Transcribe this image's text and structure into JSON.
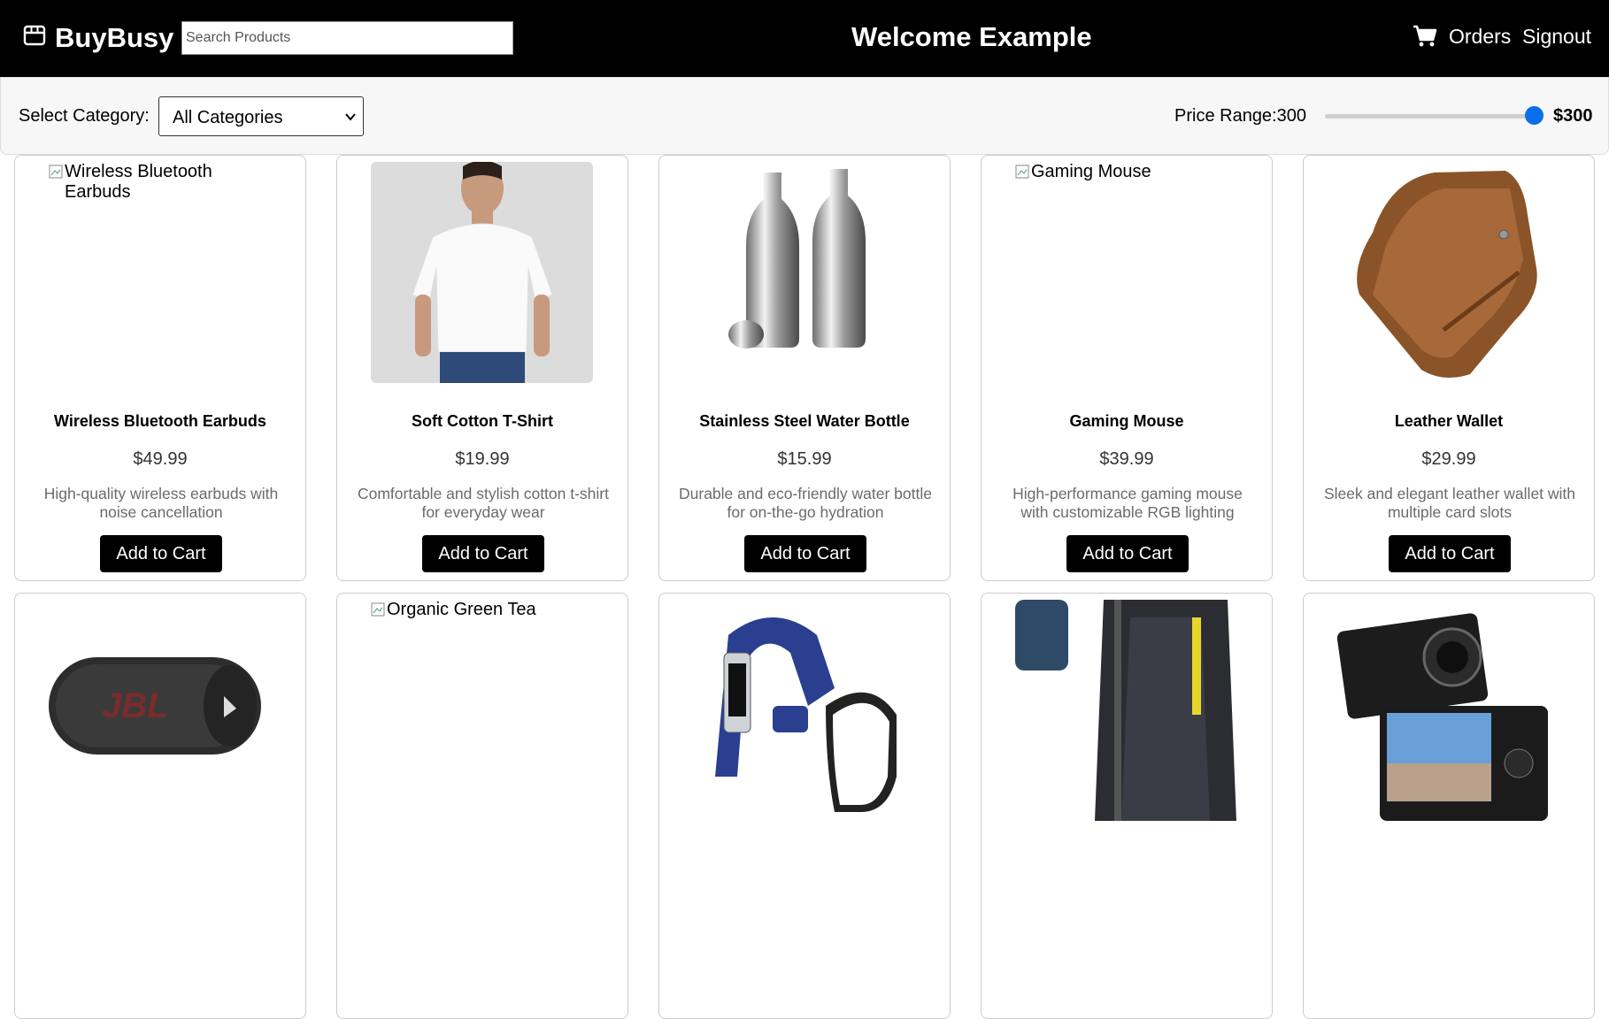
{
  "header": {
    "brand": "BuyBusy",
    "search_placeholder": "Search Products",
    "welcome": "Welcome Example",
    "nav_orders": "Orders",
    "nav_signout": "Signout"
  },
  "filters": {
    "category_label": "Select Category:",
    "category_selected": "All Categories",
    "price_label": "Price Range:300",
    "price_value": "$300",
    "price_slider_level": 1.0
  },
  "products": [
    {
      "title": "Wireless Bluetooth Earbuds",
      "price": "$49.99",
      "desc": "High-quality wireless earbuds with noise cancellation",
      "button": "Add to Cart",
      "image_alt": "Wireless Bluetooth Earbuds",
      "image_state": "broken"
    },
    {
      "title": "Soft Cotton T-Shirt",
      "price": "$19.99",
      "desc": "Comfortable and stylish cotton t-shirt for everyday wear",
      "button": "Add to Cart",
      "image_alt": "Soft Cotton T-Shirt",
      "image_state": "tshirt"
    },
    {
      "title": "Stainless Steel Water Bottle",
      "price": "$15.99",
      "desc": "Durable and eco-friendly water bottle for on-the-go hydration",
      "button": "Add to Cart",
      "image_alt": "Stainless Steel Water Bottle",
      "image_state": "bottle"
    },
    {
      "title": "Gaming Mouse",
      "price": "$39.99",
      "desc": "High-performance gaming mouse with customizable RGB lighting",
      "button": "Add to Cart",
      "image_alt": "Gaming Mouse",
      "image_state": "broken"
    },
    {
      "title": "Leather Wallet",
      "price": "$29.99",
      "desc": "Sleek and elegant leather wallet with multiple card slots",
      "button": "Add to Cart",
      "image_alt": "Leather Wallet",
      "image_state": "wallet"
    },
    {
      "image_alt": "Bluetooth Speaker",
      "image_state": "speaker"
    },
    {
      "image_alt": "Organic Green Tea",
      "image_state": "broken"
    },
    {
      "image_alt": "Fitness Tracker",
      "image_state": "tracker"
    },
    {
      "image_alt": "Backpack",
      "image_state": "backpack"
    },
    {
      "image_alt": "Digital Camera",
      "image_state": "camera"
    }
  ],
  "colors": {
    "header_bg": "#000000",
    "slider_thumb": "#0a6fe8",
    "button_bg": "#000000"
  }
}
